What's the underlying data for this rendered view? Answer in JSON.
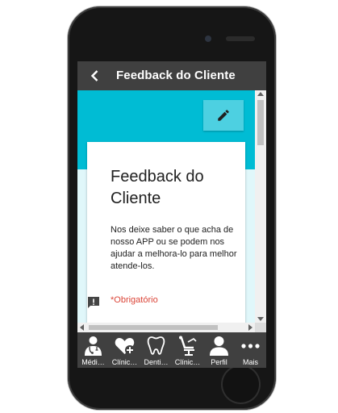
{
  "header": {
    "title": "Feedback do Cliente"
  },
  "form": {
    "title": "Feedback do Cliente",
    "description": "Nos deixe saber o que acha de nosso APP ou se podem nos ajudar a melhora-lo para melhor atende-los.",
    "required_label": "*Obrigatório"
  },
  "nav": {
    "items": [
      {
        "label": "Médi…",
        "icon": "doctor-icon"
      },
      {
        "label": "Clínic…",
        "icon": "heart-plus-icon"
      },
      {
        "label": "Denti…",
        "icon": "tooth-icon"
      },
      {
        "label": "Clínic…",
        "icon": "dental-chair-icon"
      },
      {
        "label": "Perfil",
        "icon": "person-icon"
      },
      {
        "label": "Mais",
        "icon": "more-icon"
      }
    ]
  },
  "colors": {
    "topbar": "#404040",
    "accent": "#00bcd4",
    "accent_light": "#4dd0e1",
    "background": "#e0f7fa",
    "required": "#db4437"
  }
}
